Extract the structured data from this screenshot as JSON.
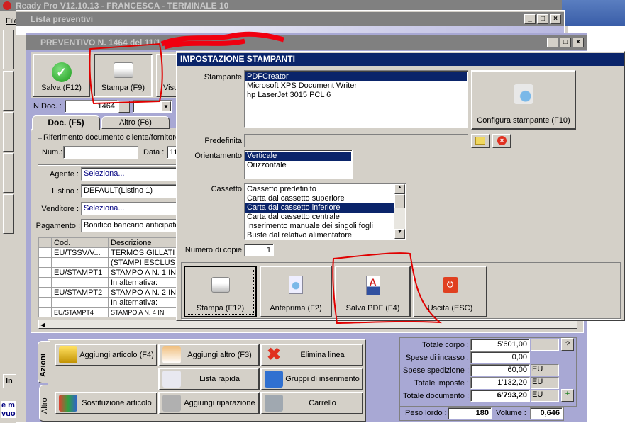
{
  "app": {
    "title": "Ready Pro V12.10.13 - FRANCESCA - TERMINALE 10",
    "menu_file": "File",
    "side_tab": "In",
    "bottom_text_1": "e m",
    "bottom_text_2": "vuo"
  },
  "lista": {
    "title": "Lista preventivi"
  },
  "preventivo": {
    "title": "PREVENTIVO N. 1464  del 11/1",
    "toolbar": {
      "save": "Salva (F12)",
      "print": "Stampa (F9)",
      "view": "Visu"
    },
    "ndoc_label": "N.Doc. :",
    "ndoc_value": "1464",
    "tabs": [
      "Doc. (F5)",
      "Altro (F6)"
    ],
    "ref_group": "Riferimento documento cliente/fornitore",
    "num_label": "Num.:",
    "num_value": "",
    "data_label": "Data :",
    "data_value": "11",
    "agente_label": "Agente :",
    "agente_value": "Seleziona...",
    "listino_label": "Listino :",
    "listino_value": "DEFAULT(Listino 1)",
    "venditore_label": "Venditore :",
    "venditore_value": "Seleziona...",
    "pagamento_label": "Pagamento :",
    "pagamento_value": "Bonifico bancario anticipato",
    "table": {
      "headers": [
        "Cod.",
        "Descrizione"
      ],
      "rows": [
        [
          "EU/TSSV/V...",
          "TERMOSIGILLATI"
        ],
        [
          "",
          "(STAMPI ESCLUS"
        ],
        [
          "EU/STAMPT1",
          "STAMPO A N. 1 IN"
        ],
        [
          "",
          "In alternativa:"
        ],
        [
          "EU/STAMPT2",
          "STAMPO A N. 2 IN"
        ],
        [
          "",
          "In alternativa:"
        ],
        [
          "EU/STAMPT4",
          "STAMPO A N. 4 IN"
        ]
      ]
    },
    "action_tabs": [
      "Azioni",
      "Altro"
    ],
    "actions": [
      "Aggiungi articolo (F4)",
      "Aggiungi altro (F3)",
      "Elimina linea",
      "Lista rapida",
      "Gruppi di inserimento",
      "Sostituzione articolo",
      "Aggiungi riparazione",
      "Carrello"
    ],
    "totals": {
      "totale_corpo_label": "Totale corpo :",
      "totale_corpo": "5'601,00",
      "spese_incasso_label": "Spese di incasso :",
      "spese_incasso": "0,00",
      "spese_spedizione_label": "Spese spedizione :",
      "spese_spedizione": "60,00",
      "totale_imposte_label": "Totale imposte :",
      "totale_imposte": "1'132,20",
      "totale_documento_label": "Totale documento :",
      "totale_documento": "6'793,20",
      "currency": "EU",
      "help": "?",
      "peso_label": "Peso lordo :",
      "peso": "180",
      "volume_label": "Volume :",
      "volume": "0,646"
    }
  },
  "dialog": {
    "title": "IMPOSTAZIONE STAMPANTI",
    "stampante_label": "Stampante",
    "printers": [
      "PDFCreator",
      "Microsoft XPS Document Writer",
      "hp LaserJet 3015 PCL 6"
    ],
    "configure": "Configura stampante (F10)",
    "predefinita_label": "Predefinita",
    "predefinita_value": "",
    "orientamento_label": "Orientamento",
    "orientations": [
      "Verticale",
      "Orizzontale"
    ],
    "cassetto_label": "Cassetto",
    "trays": [
      "Cassetto predefinito",
      "Carta dal cassetto superiore",
      "Carta dal cassetto inferiore",
      "Carta dal cassetto centrale",
      "Inserimento manuale dei singoli fogli",
      "Buste dal relativo alimentatore"
    ],
    "copie_label": "Numero di copie",
    "copie_value": "1",
    "buttons": [
      "Stampa (F12)",
      "Anteprima (F2)",
      "Salva PDF (F4)",
      "Uscita (ESC)"
    ]
  },
  "colors": {
    "titlebar_active": "#0a246a",
    "titlebar_inactive": "#808080",
    "face": "#d4d0c8",
    "annotation": "#e00000"
  }
}
